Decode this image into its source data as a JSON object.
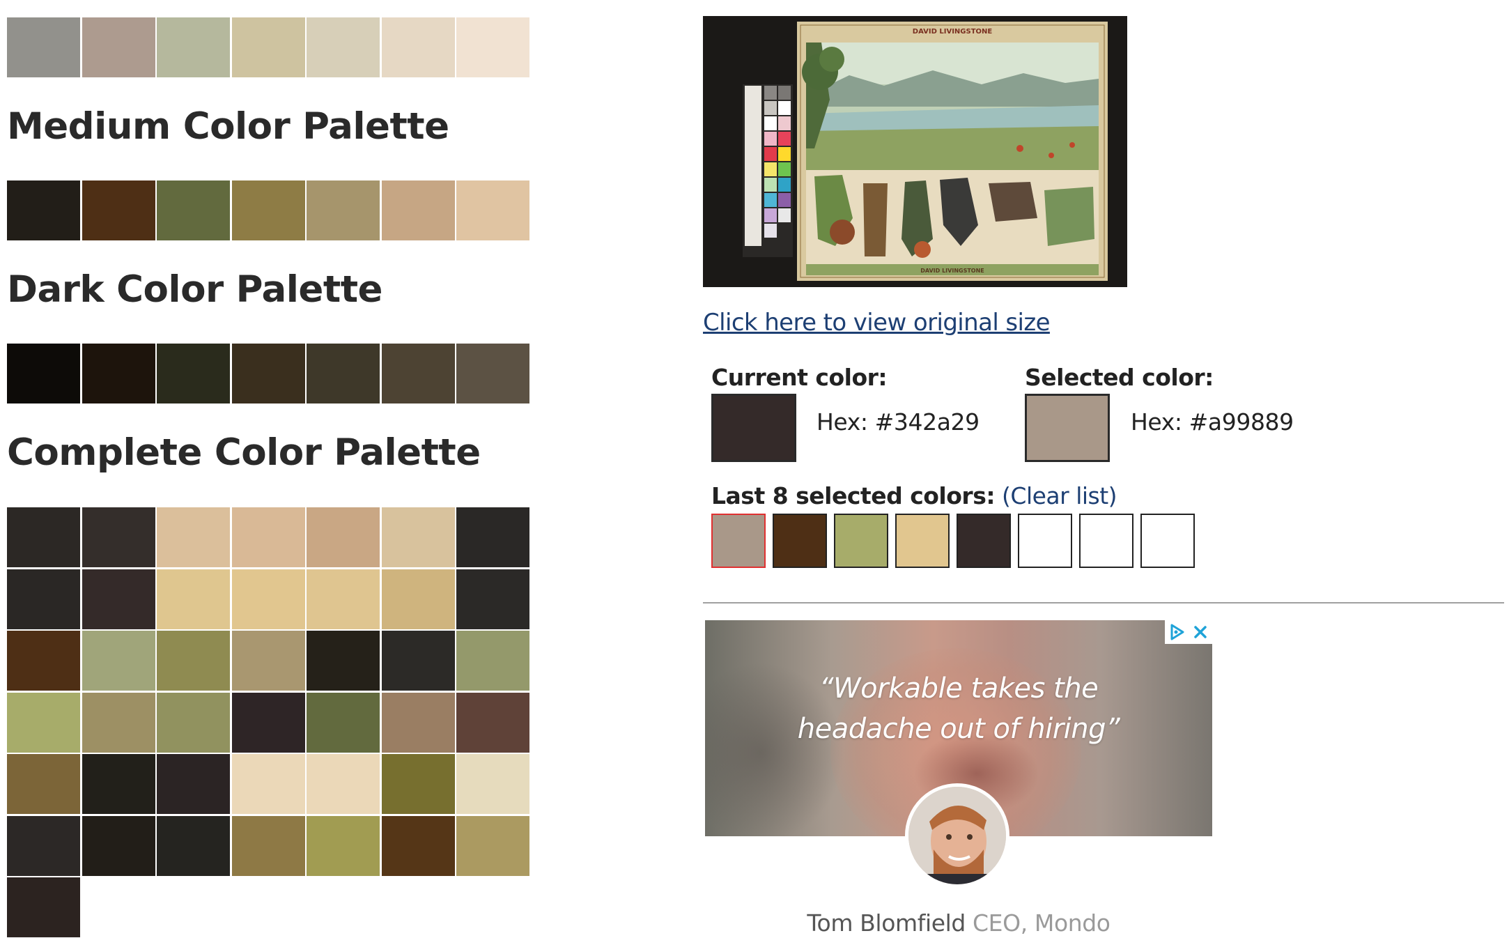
{
  "palettes": {
    "light": {
      "colors": [
        "#92918c",
        "#ad9b8f",
        "#b5b89d",
        "#cec3a0",
        "#d7cfb8",
        "#e6d8c4",
        "#f1e2d2"
      ]
    },
    "medium": {
      "title": "Medium Color Palette",
      "colors": [
        "#221e18",
        "#4e2f15",
        "#626a3e",
        "#8e7c45",
        "#a6956c",
        "#c6a684",
        "#e0c4a2"
      ]
    },
    "dark": {
      "title": "Dark Color Palette",
      "colors": [
        "#0d0b08",
        "#1d140c",
        "#2a2b1c",
        "#3a2f1e",
        "#3e3829",
        "#4d4333",
        "#5c5244"
      ]
    },
    "complete": {
      "title": "Complete Color Palette",
      "colors": [
        "#2c2825",
        "#342e2b",
        "#dbbf9b",
        "#d9b996",
        "#c9a784",
        "#d8c29d",
        "#2a2826",
        "#2a2725",
        "#342a29",
        "#dfc68f",
        "#e1c68f",
        "#dfc590",
        "#cfb47e",
        "#2b2927",
        "#4e2f15",
        "#a0a57a",
        "#8f8b51",
        "#a99770",
        "#252119",
        "#2c2a27",
        "#94996b",
        "#a7ac6a",
        "#9d9064",
        "#91925f",
        "#2e2526",
        "#626a3e",
        "#9a7e63",
        "#5f4238",
        "#7c6538",
        "#22201a",
        "#2b2424",
        "#ebd8b8",
        "#ebd8b8",
        "#776f2f",
        "#e6dbbd",
        "#2c2826",
        "#221e18",
        "#252420",
        "#8e7945",
        "#a19c52",
        "#553617",
        "#ab9a61",
        "#2c2320"
      ]
    }
  },
  "artwork": {
    "header_text": "DAVID LIVINGSTONE",
    "footer_text": "DAVID LIVINGSTONE"
  },
  "links": {
    "original_size": "Click here to view original size"
  },
  "current_color": {
    "label": "Current color:",
    "hex_text": "Hex: #342a29",
    "value": "#342a29"
  },
  "selected_color": {
    "label": "Selected color:",
    "hex_text": "Hex: #a99889",
    "value": "#a99889"
  },
  "last_selected": {
    "label": "Last 8 selected colors:",
    "clear_open": " (",
    "clear_label": "Clear list",
    "clear_close": ")",
    "colors": [
      "#a99889",
      "#4e2f15",
      "#a7ac6a",
      "#e1c68f",
      "#342a29",
      "#ffffff",
      "#ffffff",
      "#ffffff"
    ]
  },
  "ad": {
    "quote_line1": "“Workable takes the",
    "quote_line2": "headache out of hiring”",
    "person_name": "Tom Blomfield",
    "person_role": " CEO, Mondo",
    "choices_icon": "adchoices-icon",
    "close_icon": "close-icon"
  }
}
